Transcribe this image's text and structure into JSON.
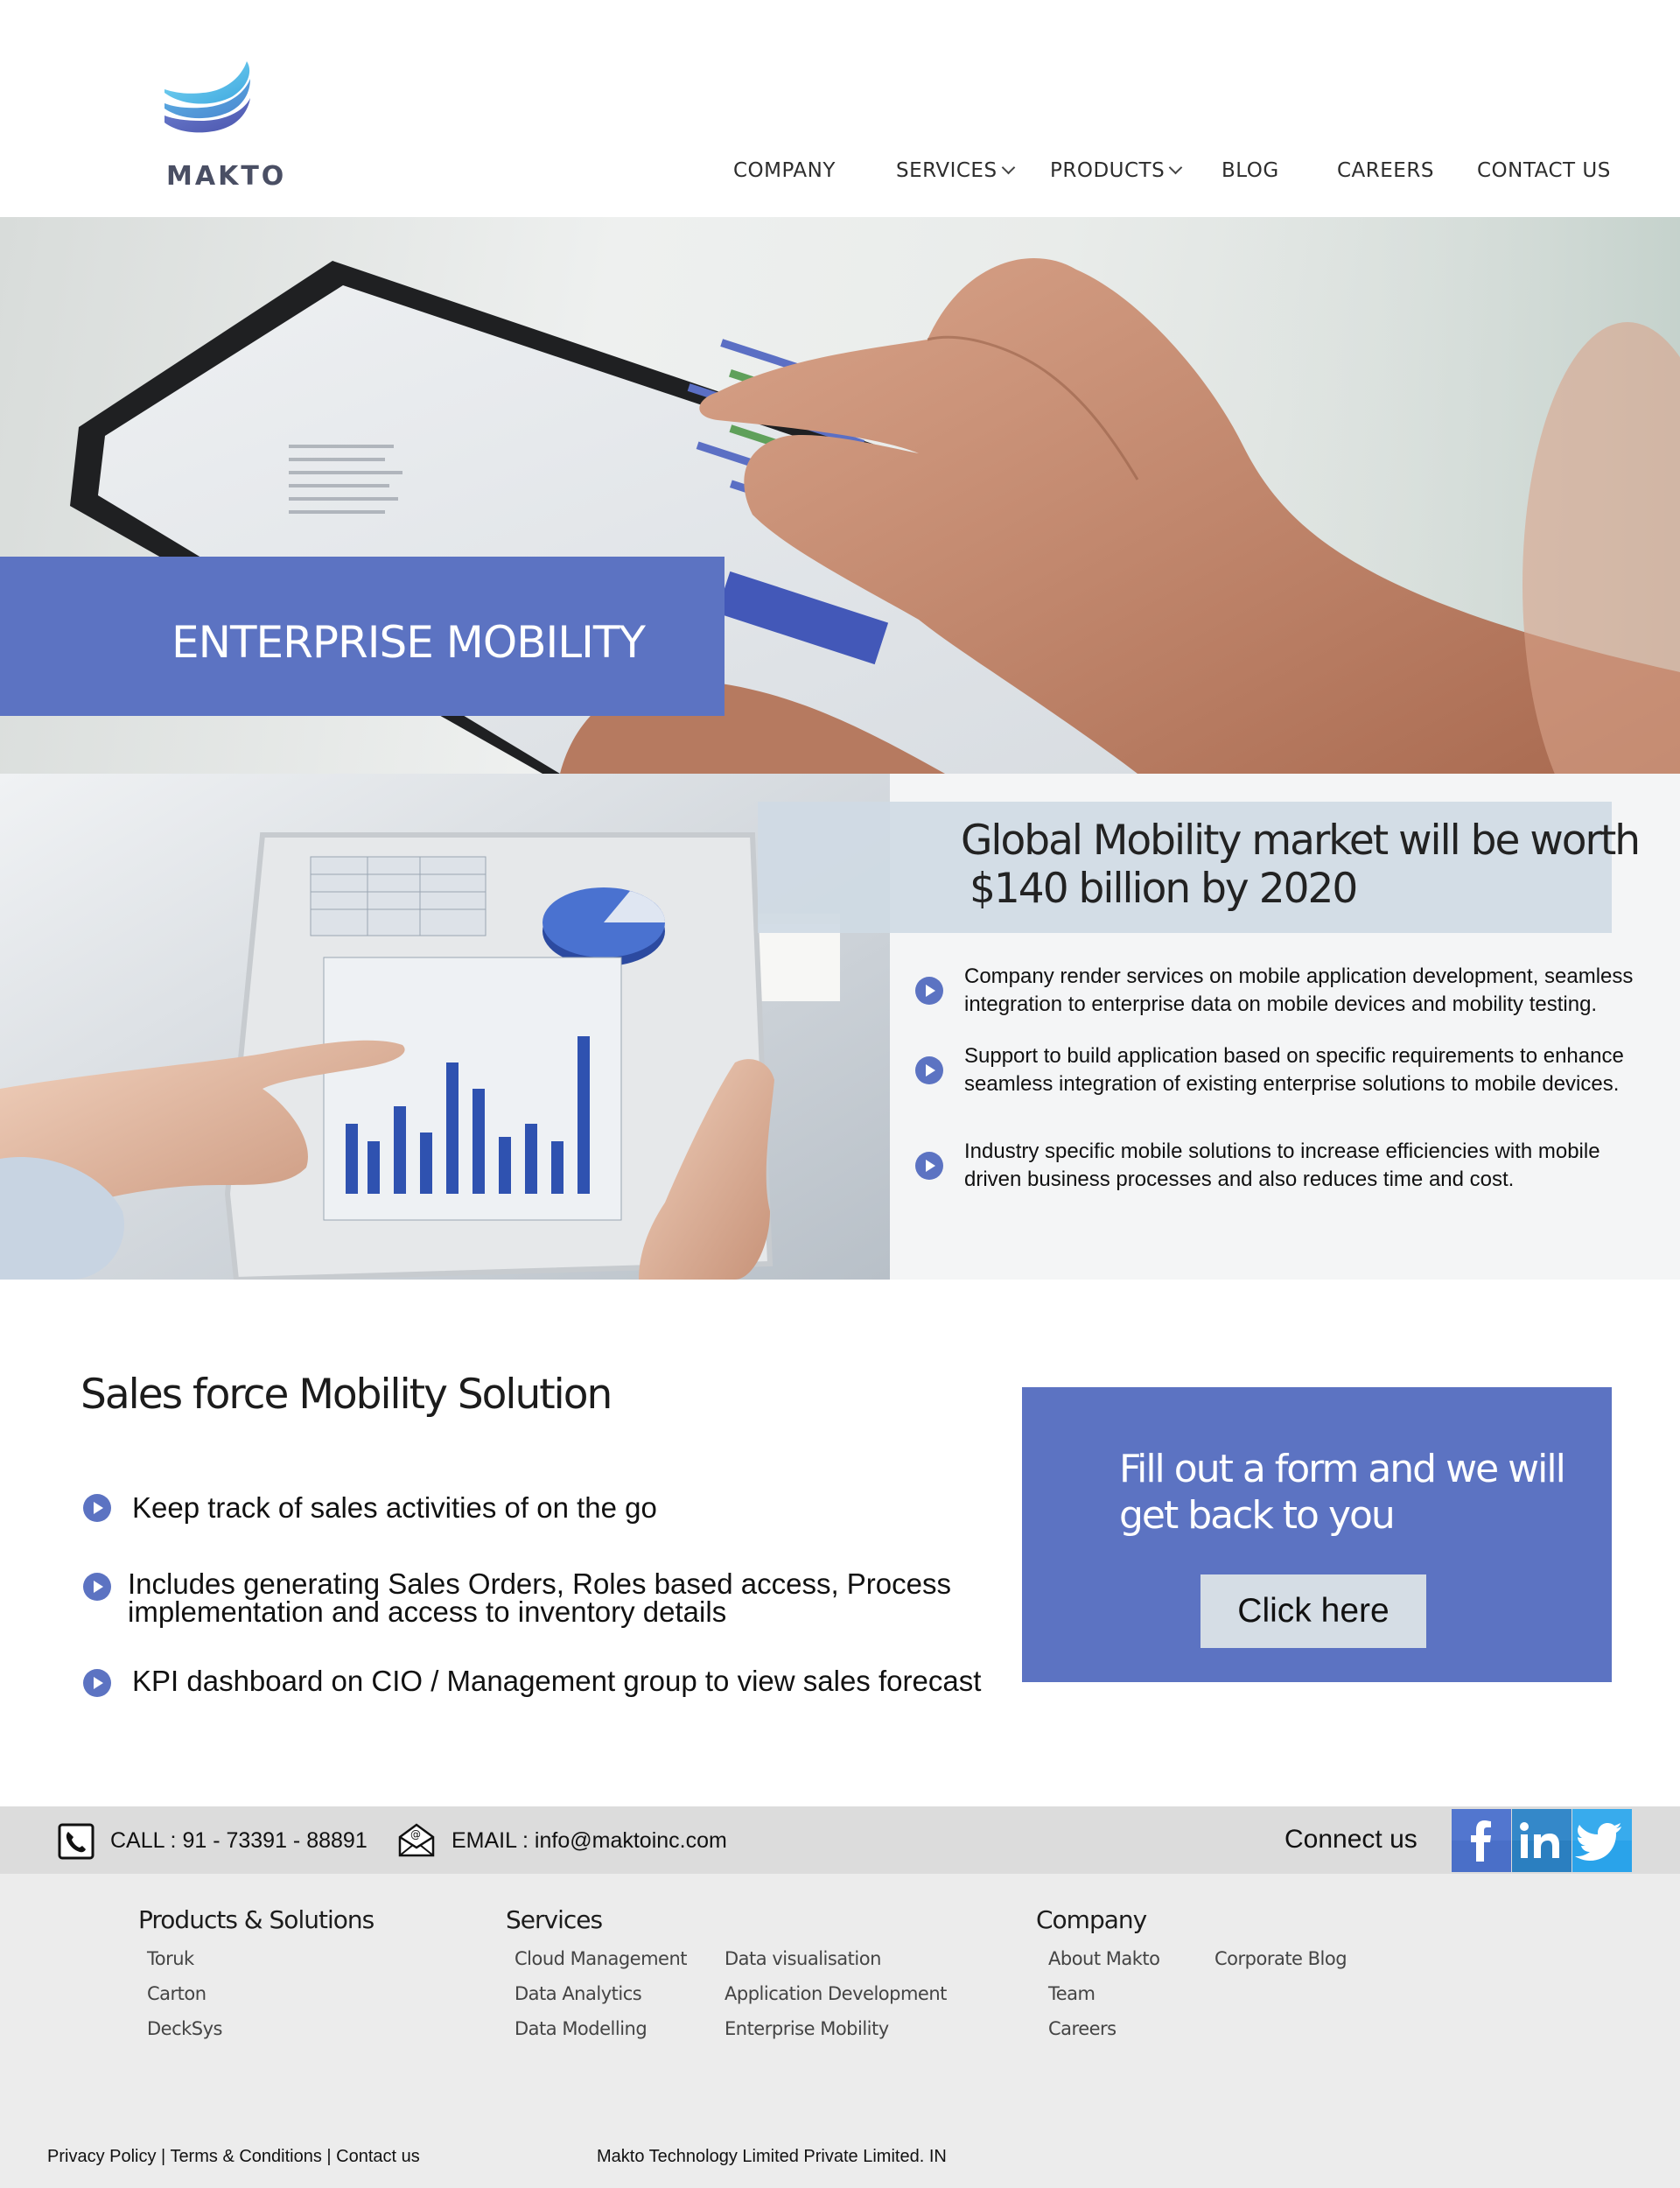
{
  "brand": {
    "name": "MAKTO",
    "colors": {
      "accent": "#5c73c2",
      "logo_light": "#5cc0e8",
      "logo_dark": "#4f5fb5"
    }
  },
  "nav": {
    "items": [
      {
        "label": "COMPANY",
        "has_dropdown": false
      },
      {
        "label": "SERVICES",
        "has_dropdown": true
      },
      {
        "label": "PRODUCTS",
        "has_dropdown": true
      },
      {
        "label": "BLOG",
        "has_dropdown": false
      },
      {
        "label": "CAREERS",
        "has_dropdown": false
      },
      {
        "label": "CONTACT US",
        "has_dropdown": false
      }
    ]
  },
  "hero": {
    "title": "ENTERPRISE MOBILITY"
  },
  "mobility": {
    "headline_line1": "Global Mobility market will be worth",
    "headline_line2": "$140 billion by 2020",
    "points": [
      "Company render services on mobile application development, seamless integration to enterprise data on mobile devices and mobility testing.",
      "Support to build application based on specific requirements to enhance seamless integration of existing enterprise solutions to mobile devices.",
      "Industry specific mobile solutions to increase efficiencies with mobile driven business processes and also reduces time and cost."
    ]
  },
  "sales": {
    "title": "Sales force Mobility Solution",
    "points": [
      "Keep track of sales activities of on the go",
      "Includes generating Sales Orders, Roles based access, Process",
      "implementation and access to inventory details",
      "KPI dashboard on CIO  / Management group to view sales forecast"
    ]
  },
  "cta": {
    "line1": "Fill out a form and we will",
    "line2": "get back to you",
    "button_label": "Click here"
  },
  "contact": {
    "call": "CALL : 91 - 73391 - 88891",
    "email": "EMAIL : info@maktoinc.com",
    "connect_label": "Connect us",
    "social_icons": [
      "facebook-icon",
      "linkedin-icon",
      "twitter-icon"
    ]
  },
  "footer": {
    "products": {
      "heading": "Products & Solutions",
      "links": [
        "Toruk",
        "Carton",
        "DeckSys"
      ]
    },
    "services": {
      "heading": "Services",
      "col1": [
        "Cloud Management",
        "Data Analytics",
        "Data Modelling"
      ],
      "col2": [
        "Data visualisation",
        "Application Development",
        "Enterprise Mobility"
      ]
    },
    "company": {
      "heading": "Company",
      "col1": [
        "About Makto",
        "Team",
        "Careers"
      ],
      "col2": [
        "Corporate Blog"
      ]
    },
    "legal": {
      "privacy": "Privacy Policy",
      "terms": "Terms & Conditions",
      "contact": "Contact us",
      "separator": " | "
    },
    "copyright": "Makto Technology Limited Private Limited. IN"
  }
}
